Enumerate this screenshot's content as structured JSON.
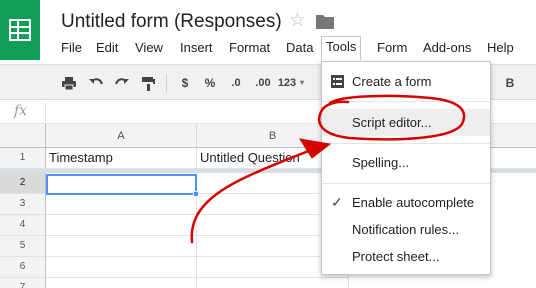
{
  "title": "Untitled form (Responses)",
  "icons": {
    "logo": "sheets-logo-icon",
    "star": "star-icon",
    "folder": "folder-icon"
  },
  "menu": [
    "File",
    "Edit",
    "View",
    "Insert",
    "Format",
    "Data",
    "Tools",
    "Form",
    "Add-ons",
    "Help"
  ],
  "active_menu": "Tools",
  "toolbar": {
    "print": "print-icon",
    "undo": "undo-icon",
    "redo": "redo-icon",
    "paint_format": "paint-format-icon",
    "currency": "$",
    "percent": "%",
    "decrease_decimals": ".0",
    "increase_decimals": ".00",
    "more_formats": "123",
    "bold": "B"
  },
  "formula_bar": {
    "label": "fx"
  },
  "grid": {
    "columns": [
      "A",
      "B"
    ],
    "rows": [
      "1",
      "2",
      "3",
      "4",
      "5",
      "6",
      "7"
    ],
    "header_cells": [
      "Timestamp",
      "Untitled Question"
    ],
    "selected_cell": "A2"
  },
  "tools_menu": {
    "items": [
      {
        "label": "Create a form",
        "icon": "form-icon"
      },
      {
        "label": "Script editor..."
      },
      {
        "label": "Spelling..."
      },
      {
        "label": "Enable autocomplete",
        "checked": true
      },
      {
        "label": "Notification rules..."
      },
      {
        "label": "Protect sheet..."
      }
    ]
  },
  "colors": {
    "brand": "#0f9d58",
    "selection": "#4d90fe",
    "annotation": "#d50000"
  }
}
